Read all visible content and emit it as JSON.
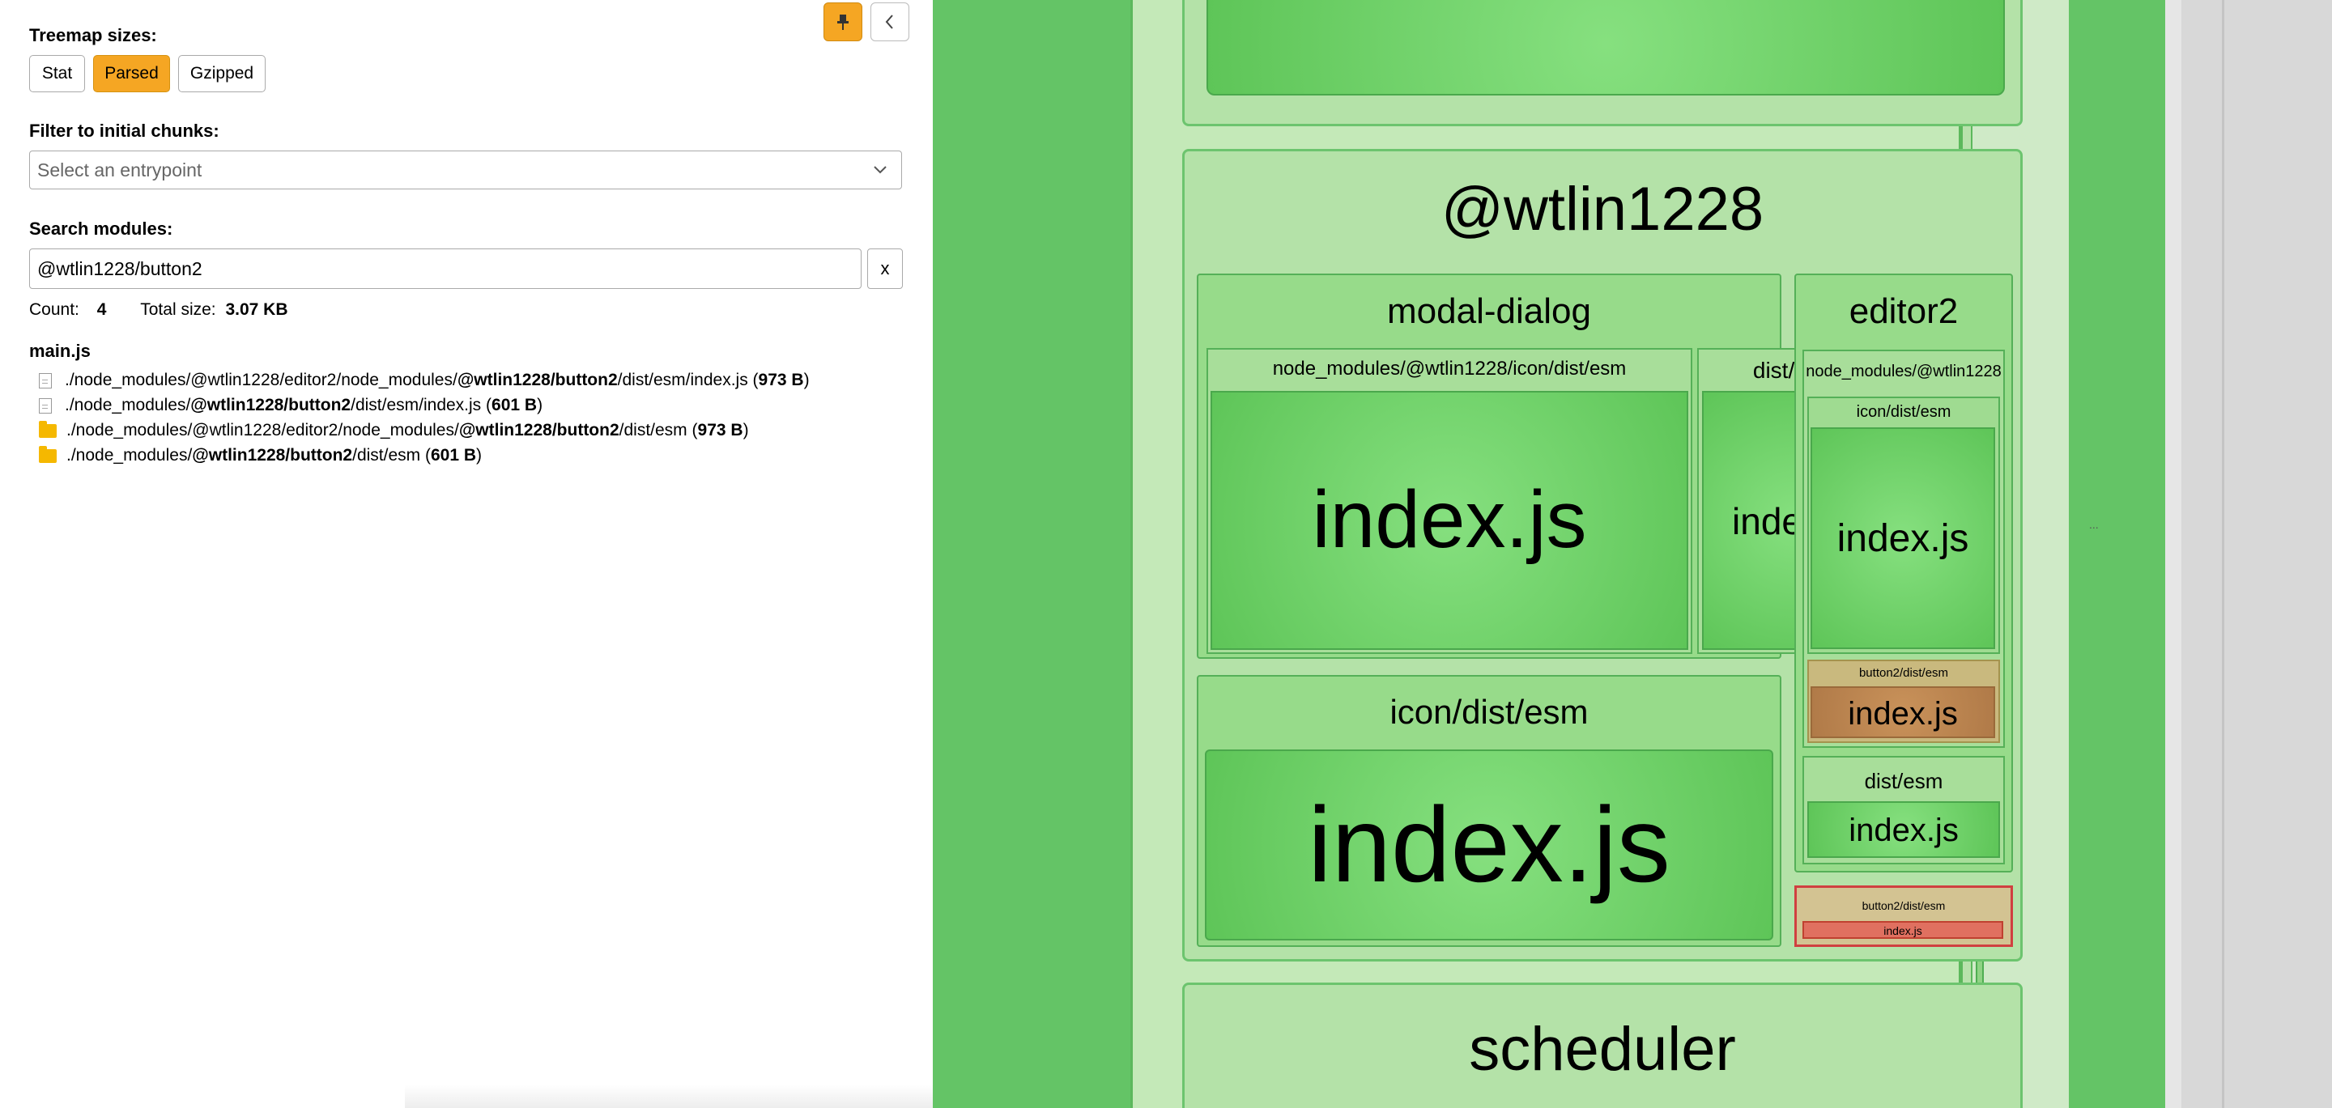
{
  "sidebar": {
    "treemap_sizes_label": "Treemap sizes:",
    "size_buttons": [
      "Stat",
      "Parsed",
      "Gzipped"
    ],
    "filter_label": "Filter to initial chunks:",
    "entrypoint_placeholder": "Select an entrypoint",
    "search_label": "Search modules:",
    "search_value": "@wtlin1228/button2",
    "clear_label": "x",
    "count_label": "Count:",
    "count_value": "4",
    "total_label": "Total size:",
    "total_value": "3.07 KB",
    "chunk_name": "main.js",
    "results": [
      {
        "icon": "file-icon",
        "prefix": "./node_modules/@wtlin1228/editor2/node_modules/",
        "match": "@wtlin1228/button2",
        "suffix": "/dist/esm/index.js (",
        "size": "973 B",
        "end": ")"
      },
      {
        "icon": "file-icon",
        "prefix": "./node_modules/",
        "match": "@wtlin1228/button2",
        "suffix": "/dist/esm/index.js (",
        "size": "601 B",
        "end": ")"
      },
      {
        "icon": "folder-icon",
        "prefix": "./node_modules/@wtlin1228/editor2/node_modules/",
        "match": "@wtlin1228/button2",
        "suffix": "/dist/esm (",
        "size": "973 B",
        "end": ")"
      },
      {
        "icon": "folder-icon",
        "prefix": "./node_modules/",
        "match": "@wtlin1228/button2",
        "suffix": "/dist/esm (",
        "size": "601 B",
        "end": ")"
      }
    ],
    "pin_icon": "pin-icon",
    "collapse_icon": "chevron-left-icon"
  },
  "treemap": {
    "group_title": "@wtlin1228",
    "modal_dialog": "modal-dialog",
    "modal_icon_path": "node_modules/@wtlin1228/icon/dist/esm",
    "modal_dist": "dist/esm",
    "editor2": "editor2",
    "editor2_nm": "node_modules/@wtlin1228",
    "editor2_icon": "icon/dist/esm",
    "editor2_button2": "button2/dist/esm",
    "editor2_dist": "dist/esm",
    "icon_dist": "icon/dist/esm",
    "button2_dist": "button2/dist/esm",
    "index_js": "index.js",
    "scheduler": "scheduler",
    "ellipsis": "..."
  }
}
